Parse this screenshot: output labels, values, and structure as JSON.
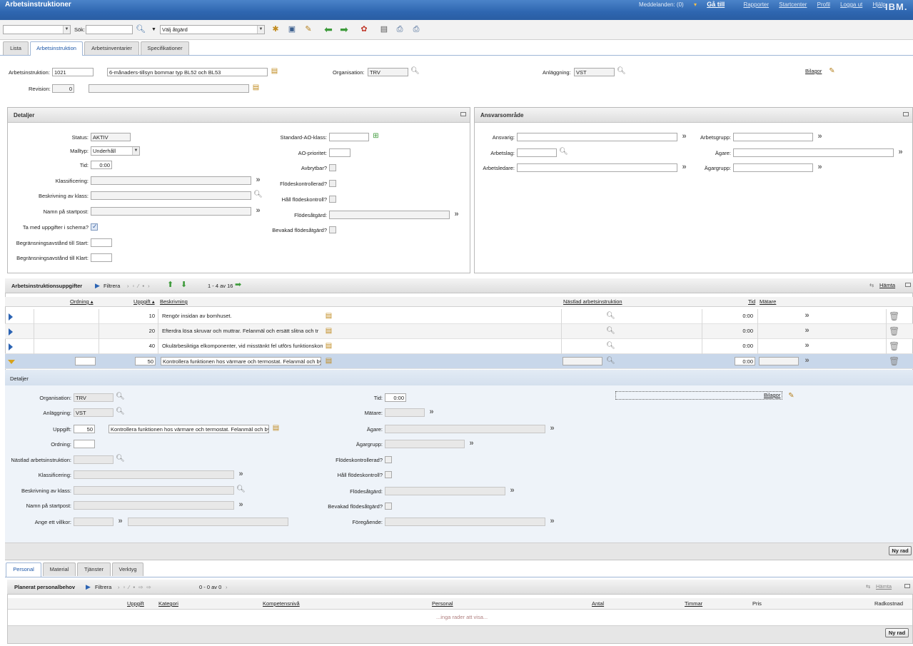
{
  "app": {
    "title": "Arbetsinstruktioner"
  },
  "top": {
    "messages": "Meddelanden: (0)",
    "goto": "Gå till",
    "reports": "Rapporter",
    "startcenter": "Startcenter",
    "profile": "Profil",
    "logout": "Logga ut",
    "help": "Hjälp",
    "brand": "IBM."
  },
  "toolbar": {
    "search_label": "Sök:",
    "action_select": "Välj åtgärd"
  },
  "tabs": [
    "Lista",
    "Arbetsinstruktion",
    "Arbetsinventarier",
    "Specifikationer"
  ],
  "header": {
    "wi_label": "Arbetsinstruktion:",
    "wi_value": "1021",
    "wi_desc": "6-månaders-tillsyn bommar typ BL52 och BL53",
    "org_label": "Organisation:",
    "org_value": "TRV",
    "site_label": "Anläggning:",
    "site_value": "VST",
    "rev_label": "Revision:",
    "rev_value": "0",
    "attach": "Bilagor"
  },
  "details": {
    "title": "Detaljer",
    "status_label": "Status:",
    "status_value": "AKTIV",
    "type_label": "Malltyp:",
    "type_value": "Underhåll",
    "time_label": "Tid:",
    "time_value": "0:00",
    "class_label": "Klassificering:",
    "classdesc_label": "Beskrivning av klass:",
    "startpost_label": "Namn på startpost:",
    "schedule_label": "Ta med uppgifter i schema?",
    "limit_start_label": "Begränsningsavstånd till Start:",
    "limit_done_label": "Begränsningsavstånd till Klart:",
    "std_class_label": "Standard-AO-klass:",
    "priority_label": "AO-prioritet:",
    "interrupt_label": "Avbrytbar?",
    "flow_label": "Flödeskontrollerad?",
    "keepflow_label": "Håll flödeskontroll?",
    "flowaction_label": "Flödesåtgärd:",
    "watchflow_label": "Bevakad flödesåtgärd?"
  },
  "resp": {
    "title": "Ansvarsområde",
    "responsible": "Ansvarig:",
    "crew": "Arbetslag:",
    "supervisor": "Arbetsledare:",
    "workgroup": "Arbetsgrupp:",
    "owner": "Ägare:",
    "ownergroup": "Ägargrupp:"
  },
  "tasks": {
    "title": "Arbetsinstruktionsuppgifter",
    "filter": "Filtrera",
    "count": "1 - 4 av 16",
    "fetch": "Hämta",
    "columns": {
      "order": "Ordning",
      "task": "Uppgift",
      "desc": "Beskrivning",
      "next": "Nästlad arbetsinstruktion",
      "time": "Tid",
      "meter": "Mätare"
    },
    "rows": [
      {
        "order": "",
        "task": "10",
        "desc": "Rengör insidan av bomhuset.",
        "time": "0:00"
      },
      {
        "order": "",
        "task": "20",
        "desc": "Efterdra lösa skruvar och muttrar. Felanmäl och ersätt slitna och tr",
        "time": "0:00"
      },
      {
        "order": "",
        "task": "40",
        "desc": "Okulärbesiktiga elkomponenter, vid misstänkt fel utförs funktionskon",
        "time": "0:00"
      },
      {
        "order": "",
        "task": "50",
        "desc": "Kontrollera funktionen hos värmare och termostat. Felanmäl och byt",
        "time": "0:00"
      }
    ]
  },
  "taskdetail": {
    "title": "Detaljer",
    "org_label": "Organisation:",
    "org_value": "TRV",
    "site_label": "Anläggning:",
    "site_value": "VST",
    "task_label": "Uppgift:",
    "task_value": "50",
    "task_desc": "Kontrollera funktionen hos värmare och termostat. Felanmäl och byt",
    "order_label": "Ordning:",
    "nested_label": "Nästlad arbetsinstruktion:",
    "class_label": "Klassificering:",
    "classdesc_label": "Beskrivning av klass:",
    "startpost_label": "Namn på startpost:",
    "cond_label": "Ange ett villkor:",
    "time_label": "Tid:",
    "time_value": "0:00",
    "meter_label": "Mätare:",
    "owner_label": "Ägare:",
    "ownergroup_label": "Ägargrupp:",
    "flow_label": "Flödeskontrollerad?",
    "keepflow_label": "Håll flödeskontroll?",
    "flowaction_label": "Flödesåtgärd:",
    "watchflow_label": "Bevakad flödesåtgärd?",
    "prev_label": "Föregående:",
    "attach": "Bilagor",
    "newrow": "Ny rad"
  },
  "subtabs": [
    "Personal",
    "Material",
    "Tjänster",
    "Verktyg"
  ],
  "labor": {
    "title": "Planerat personalbehov",
    "filter": "Filtrera",
    "count": "0 - 0 av 0",
    "fetch": "Hämta",
    "columns": {
      "task": "Uppgift",
      "category": "Kategori",
      "skill": "Kompetensnivå",
      "person": "Personal",
      "qty": "Antal",
      "hours": "Timmar",
      "price": "Pris",
      "cost": "Radkostnad"
    },
    "empty": "...inga rader att visa...",
    "newrow": "Ny rad"
  }
}
